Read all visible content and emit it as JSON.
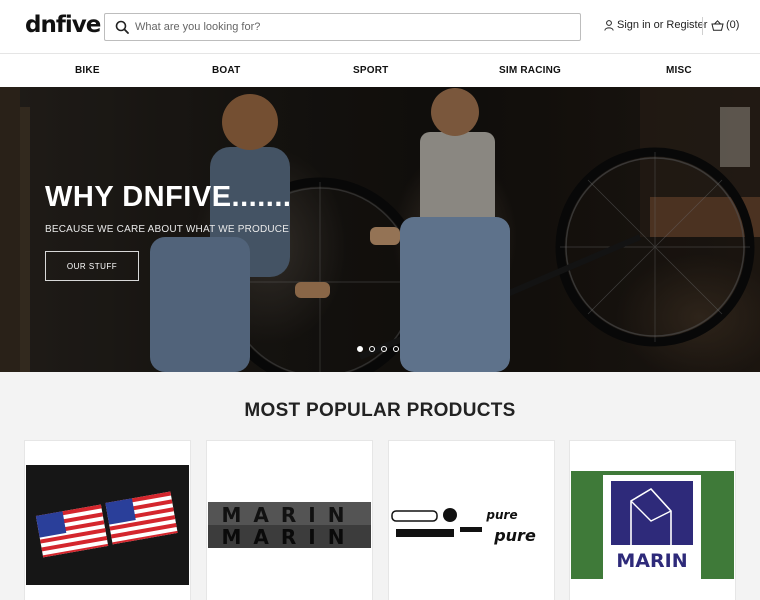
{
  "header": {
    "logo": "dnfive",
    "search_placeholder": "What are you looking for?",
    "sign_in": "Sign in",
    "or": "or",
    "register": "Register",
    "cart_count": "(0)"
  },
  "nav": {
    "items": [
      {
        "label": "BIKE"
      },
      {
        "label": "BOAT"
      },
      {
        "label": "SPORT"
      },
      {
        "label": "SIM RACING"
      },
      {
        "label": "MISC"
      }
    ]
  },
  "hero": {
    "title": "WHY DNFIVE.......",
    "subtitle": "BECAUSE WE CARE ABOUT WHAT WE PRODUCE",
    "button": "OUR STUFF",
    "slide_count": 4,
    "active_slide": 1
  },
  "products": {
    "title": "MOST POPULAR PRODUCTS",
    "items": [
      {
        "image": "usa-flag-decals"
      },
      {
        "image": "marin-text-decals",
        "text": "MARIN"
      },
      {
        "image": "pure-racing-decal-set",
        "text": "pure"
      },
      {
        "image": "marin-logo-decal",
        "text": "MARIN"
      }
    ]
  },
  "colors": {
    "accent": "#222222",
    "section_bg": "#f3f3f3"
  }
}
